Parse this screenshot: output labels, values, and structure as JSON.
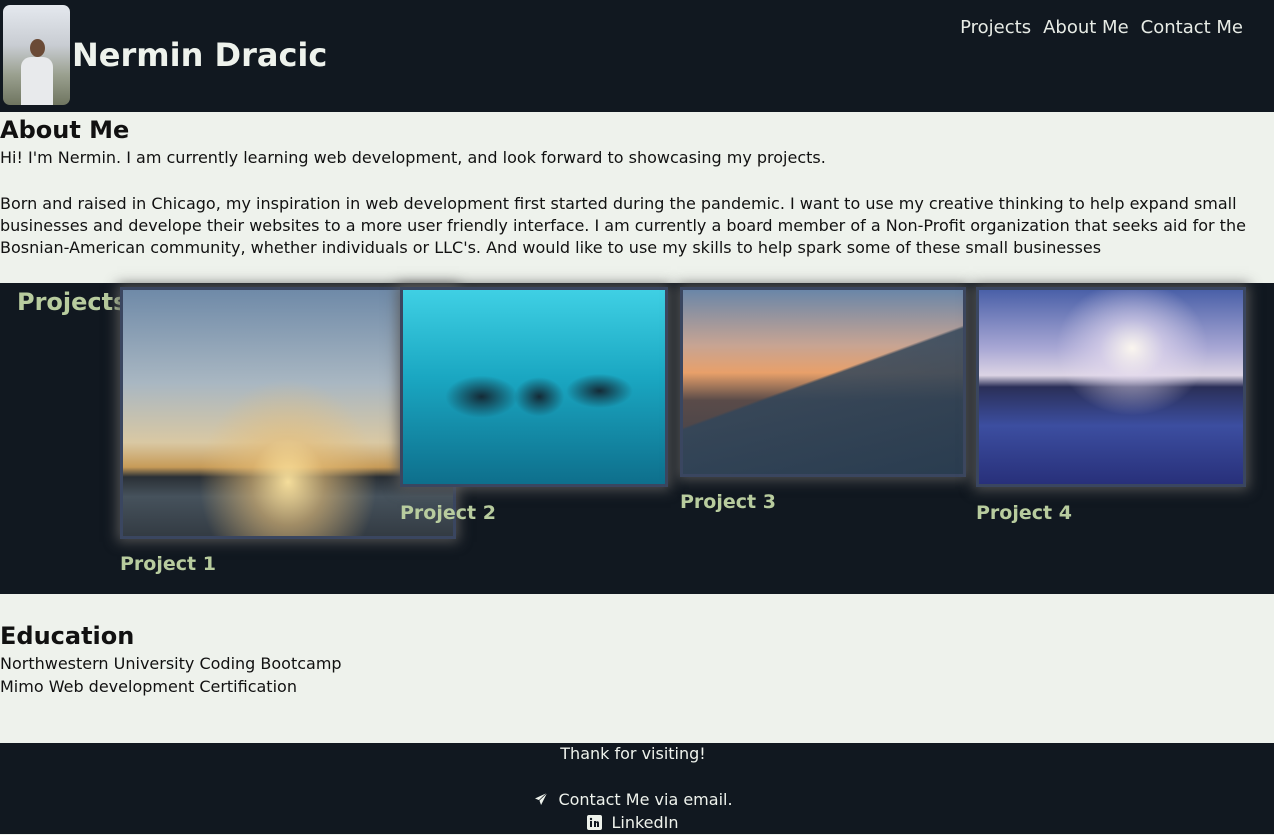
{
  "header": {
    "name": "Nermin Dracic",
    "nav": [
      "Projects",
      "About Me",
      "Contact Me"
    ]
  },
  "about": {
    "heading": "About Me",
    "intro": "Hi! I'm Nermin. I am currently learning web development, and look forward to showcasing my projects.",
    "bio": "Born and raised in Chicago, my inspiration in web development first started during the pandemic. I want to use my creative thinking to help expand small businesses and develope their websites to a more user friendly interface. I am currently a board member of a Non-Profit organization that seeks aid for the Bosnian-American community, whether individuals or LLC's. And would like to use my skills to help spark some of these small businesses"
  },
  "projects": {
    "heading": "Projects",
    "items": [
      {
        "label": "Project 1"
      },
      {
        "label": "Project 2"
      },
      {
        "label": "Project 3"
      },
      {
        "label": "Project 4"
      }
    ]
  },
  "education": {
    "heading": "Education",
    "items": [
      "Northwestern University Coding Bootcamp",
      "Mimo Web development Certification"
    ]
  },
  "footer": {
    "thanks": "Thank for visiting!",
    "email_label": "Contact Me via email.",
    "linkedin_label": "LinkedIn"
  },
  "icons": {
    "email": "paper-plane-icon",
    "linkedin": "linkedin-icon"
  },
  "colors": {
    "dark_bg": "#111820",
    "light_bg": "#eef2ec",
    "accent_green": "#b8cc9e",
    "card_border": "#3a4660"
  }
}
